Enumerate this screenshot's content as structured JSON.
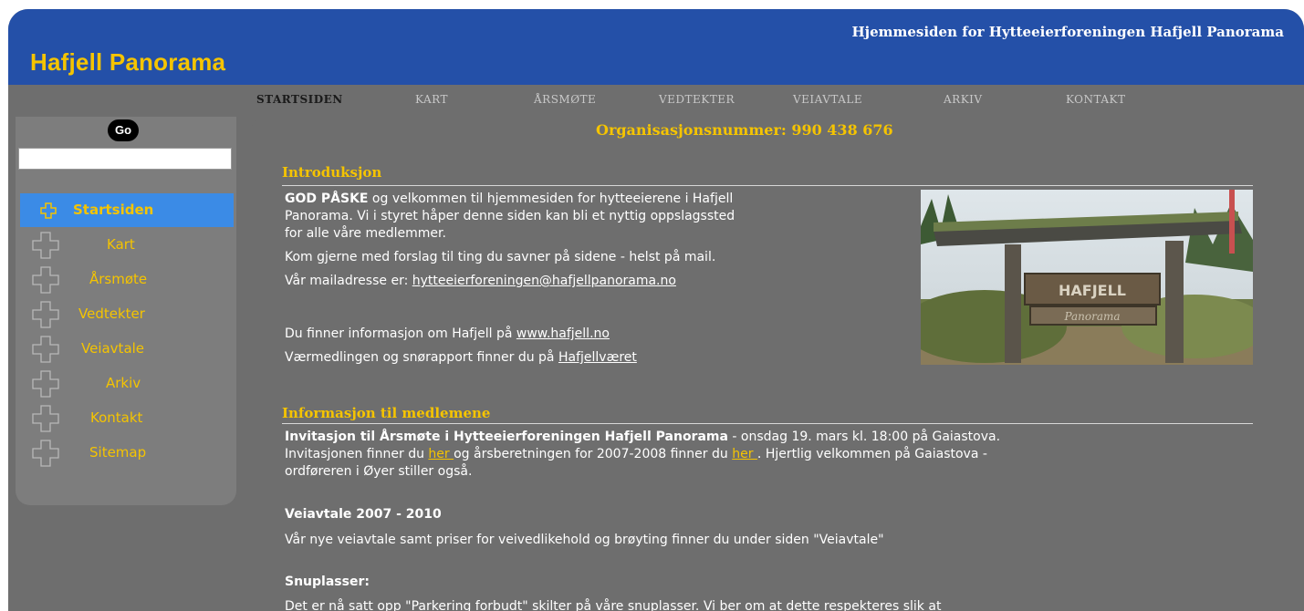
{
  "header": {
    "site_title": "Hafjell Panorama",
    "tagline": "Hjemmesiden for Hytteeierforeningen Hafjell Panorama"
  },
  "topnav": {
    "items": [
      {
        "label": "Startsiden",
        "active": true
      },
      {
        "label": "Kart",
        "active": false
      },
      {
        "label": "Årsmøte",
        "active": false
      },
      {
        "label": "Vedtekter",
        "active": false
      },
      {
        "label": "Veiavtale",
        "active": false
      },
      {
        "label": "Arkiv",
        "active": false
      },
      {
        "label": "Kontakt",
        "active": false
      }
    ]
  },
  "sidebar": {
    "go_label": "Go",
    "search_value": "",
    "items": [
      {
        "label": "Startsiden",
        "active": true
      },
      {
        "label": "Kart",
        "active": false
      },
      {
        "label": "Årsmøte",
        "active": false
      },
      {
        "label": "Vedtekter",
        "active": false
      },
      {
        "label": "Veiavtale",
        "active": false
      },
      {
        "label": "Arkiv",
        "active": false
      },
      {
        "label": "Kontakt",
        "active": false
      },
      {
        "label": "Sitemap",
        "active": false
      }
    ]
  },
  "content": {
    "orgnr": "Organisasjonsnummer: 990 438 676",
    "intro": {
      "title": "Introduksjon",
      "bold_lead": "GOD PÅSKE",
      "line1_rest": " og velkommen til hjemmesiden for hytteeierene i Hafjell",
      "line2": "Panorama. Vi i styret håper denne siden kan bli et nyttig oppslagssted",
      "line3": "for alle våre medlemmer.",
      "line4": "Kom gjerne med forslag til ting du savner på sidene - helst på mail.",
      "mail_prefix": "Vår mailadresse er: ",
      "mail_link": "hytteeierforeningen@hafjellpanorama.no",
      "info_prefix": "Du finner informasjon om Hafjell på ",
      "info_link": "www.hafjell.no",
      "weather_prefix": "Værmedlingen og snørapport finner du på ",
      "weather_link": "Hafjellværet"
    },
    "members": {
      "title": "Informasjon til medlemene",
      "invite_bold": "Invitasjon til Årsmøte i Hytteeierforeningen Hafjell Panorama",
      "invite_rest": " - onsdag 19. mars kl. 18:00 på Gaiastova.",
      "invite_l2a": "Invitasjonen finner du ",
      "invite_link1": "her ",
      "invite_l2b": "og årsberetningen for 2007-2008 finner du ",
      "invite_link2": "her ",
      "invite_l2c": ". Hjertlig velkommen på Gaiastova -",
      "invite_l3": "ordføreren i Øyer stiller også.",
      "road_title": "Veiavtale 2007 - 2010",
      "road_text": "Vår nye veiavtale samt priser for veivedlikehold og brøyting finner du under siden \"Veiavtale\"",
      "turn_title": "Snuplasser:",
      "turn_text": "Det er nå satt opp \"Parkering forbudt\" skilter på våre snuplasser. Vi ber om at dette respekteres slik at"
    },
    "photo": {
      "sign_text1": "HAFJELL",
      "sign_text2": "Panorama"
    }
  },
  "colors": {
    "header_blue": "#2450a8",
    "accent_yellow": "#f5c400",
    "active_side": "#3b8be6",
    "bg_gray": "#6e6e6e"
  }
}
